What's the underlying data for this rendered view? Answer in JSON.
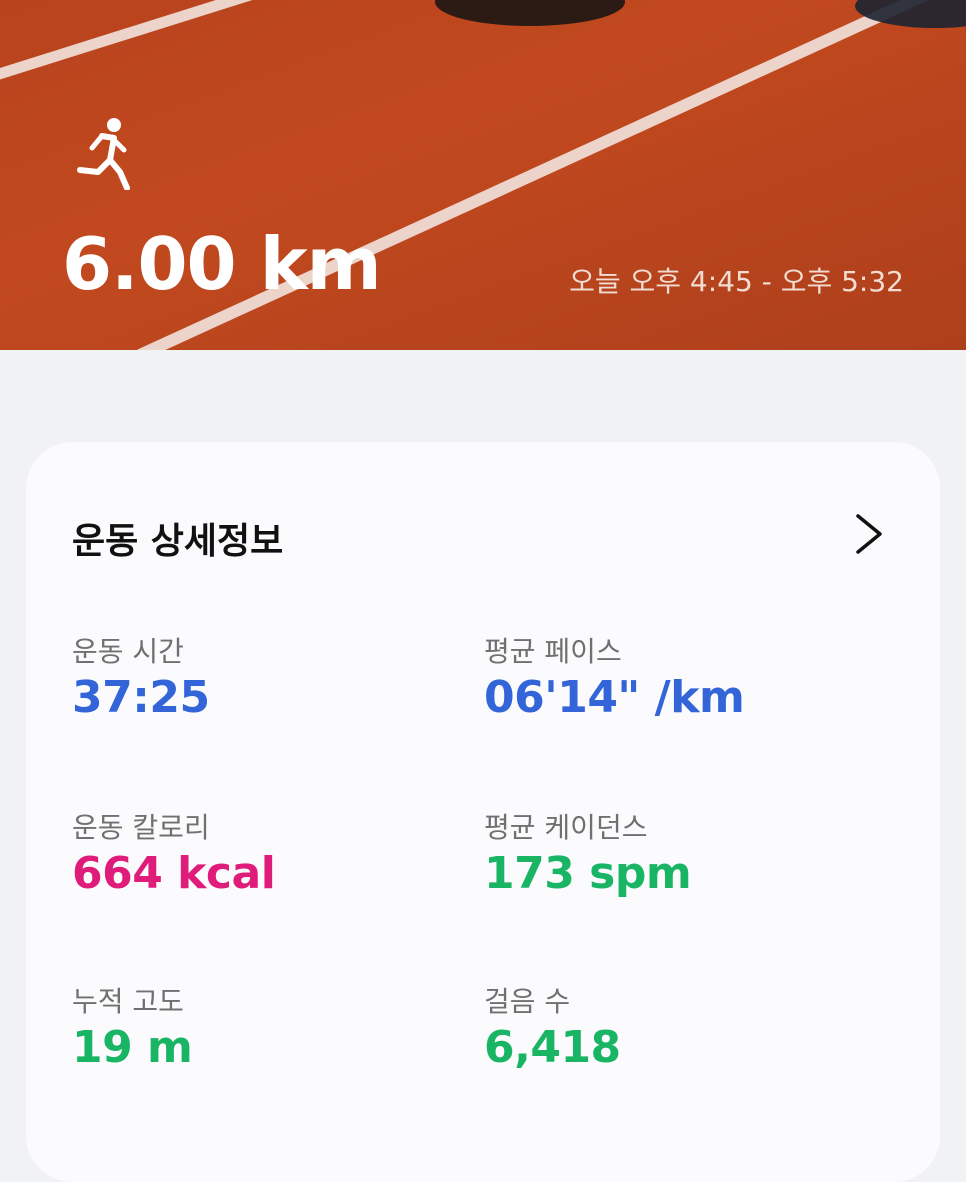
{
  "hero": {
    "icon": "running-person-icon",
    "distance": "6.00 km",
    "time_range": "오늘 오후 4:45 - 오후 5:32"
  },
  "detail": {
    "title": "운동 상세정보",
    "chevron_icon": "chevron-right-icon",
    "stats": [
      {
        "label": "운동 시간",
        "value": "37:25",
        "color": "#3365d8"
      },
      {
        "label": "평균 페이스",
        "value": "06'14\" /km",
        "color": "#3365d8"
      },
      {
        "label": "운동 칼로리",
        "value": "664 kcal",
        "color": "#e01c7b"
      },
      {
        "label": "평균 케이던스",
        "value": "173 spm",
        "color": "#19b565"
      },
      {
        "label": "누적 고도",
        "value": "19 m",
        "color": "#19b565"
      },
      {
        "label": "걸음 수",
        "value": "6,418",
        "color": "#19b565"
      }
    ]
  }
}
